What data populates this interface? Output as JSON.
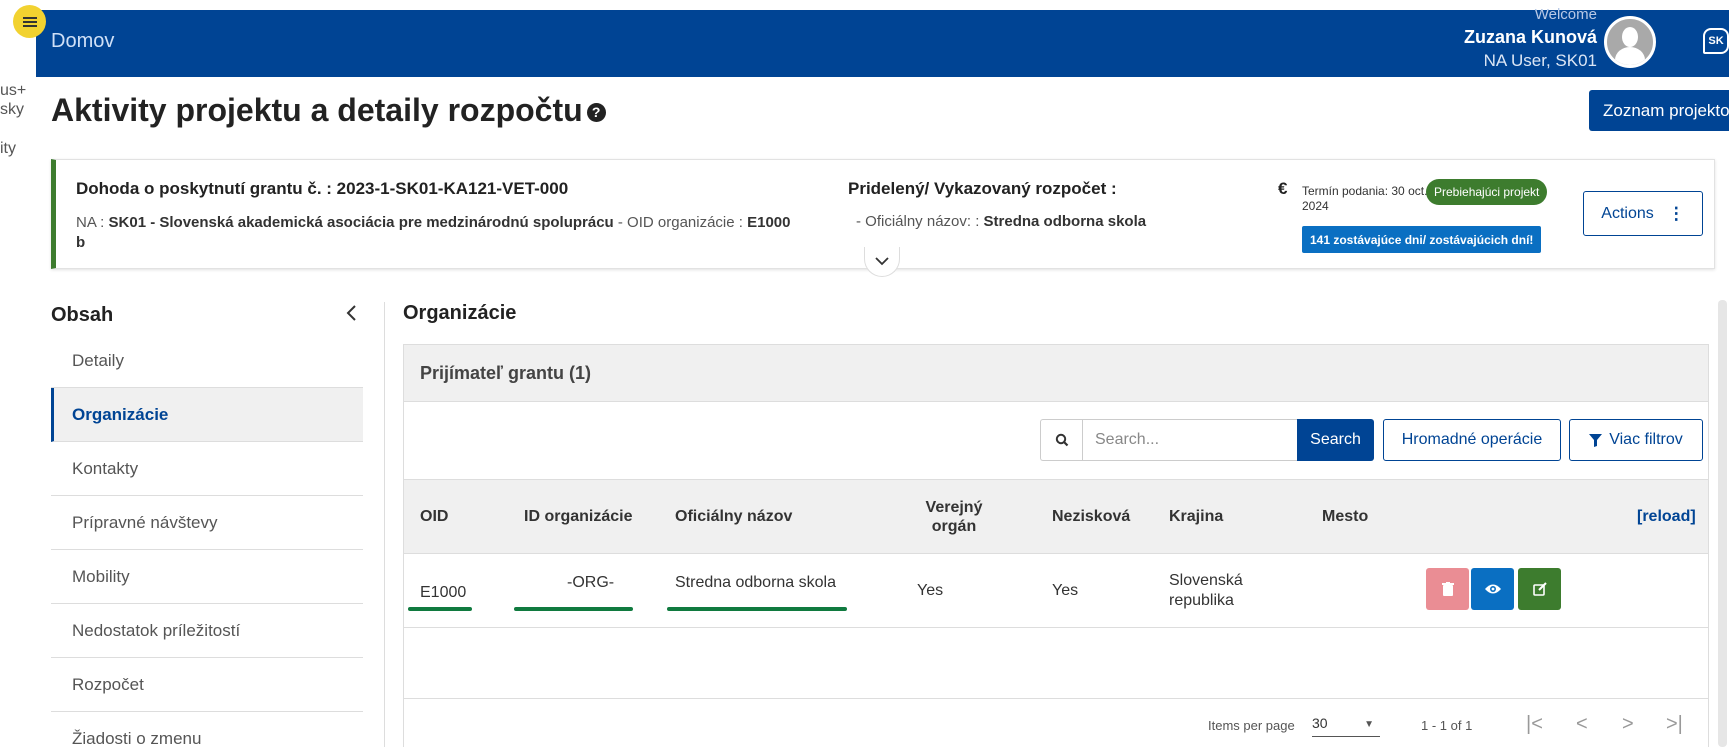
{
  "left_strip": {
    "snippets": [
      "us+",
      "sky",
      "ity"
    ]
  },
  "topbar": {
    "home": "Domov",
    "welcome": "Welcome",
    "user_name": "Zuzana Kunová",
    "user_role": "NA User, SK01",
    "lang": "SK"
  },
  "page": {
    "title": "Aktivity projektu a detaily rozpočtu",
    "projects_button": "Zoznam projektov"
  },
  "info_card": {
    "grant_label": "Dohoda o poskytnutí grantu č. : 2023-1-SK01-KA121-VET-000",
    "na_prefix": "NA : ",
    "na_value": "SK01 - Slovenská akademická asociácia pre medzinárodnú spoluprácu",
    "oid_prefix": " - OID organizácie : ",
    "oid_value": "E1000",
    "oid_suffix": "b",
    "budget_label": "Pridelený/ Vykazovaný rozpočet :",
    "currency": "€",
    "official_prefix": "- Oficiálny názov: : ",
    "official_value": "Stredna odborna skola",
    "deadline": "Termín podania: 30 oct. 2024",
    "status_badge": "Prebiehajúci projekt",
    "days_badge": "141 zostávajúce dni/ zostávajúcich dní!",
    "actions": "Actions"
  },
  "sidebar": {
    "title": "Obsah",
    "items": [
      {
        "label": "Detaily",
        "active": false
      },
      {
        "label": "Organizácie",
        "active": true
      },
      {
        "label": "Kontakty",
        "active": false
      },
      {
        "label": "Prípravné návštevy",
        "active": false
      },
      {
        "label": "Mobility",
        "active": false
      },
      {
        "label": "Nedostatok príležitostí",
        "active": false
      },
      {
        "label": "Rozpočet",
        "active": false
      },
      {
        "label": "Žiadosti o zmenu",
        "active": false
      }
    ]
  },
  "main": {
    "section_title": "Organizácie",
    "panel_title": "Prijímateľ grantu (1)",
    "search_placeholder": "Search...",
    "search_button": "Search",
    "bulk_button": "Hromadné operácie",
    "filter_button": "Viac filtrov",
    "columns": {
      "oid": "OID",
      "org_id": "ID organizácie",
      "official_name": "Oficiálny názov",
      "public_body": "Verejný orgán",
      "non_profit": "Nezisková",
      "country": "Krajina",
      "city": "Mesto",
      "reload": "[reload]"
    },
    "rows": [
      {
        "oid": "E1000",
        "org_id": "-ORG-",
        "official_name": "Stredna odborna skola",
        "public_body": "Yes",
        "non_profit": "Yes",
        "country": "Slovenská republika",
        "city": ""
      }
    ],
    "pagination": {
      "items_per_page_label": "Items per page",
      "items_per_page": "30",
      "range": "1 - 1 of 1"
    }
  },
  "colors": {
    "primary": "#004494",
    "success": "#3d7c2e",
    "info": "#0a6fc2",
    "danger_light": "#ea8d94",
    "highlight": "#f2d230"
  }
}
